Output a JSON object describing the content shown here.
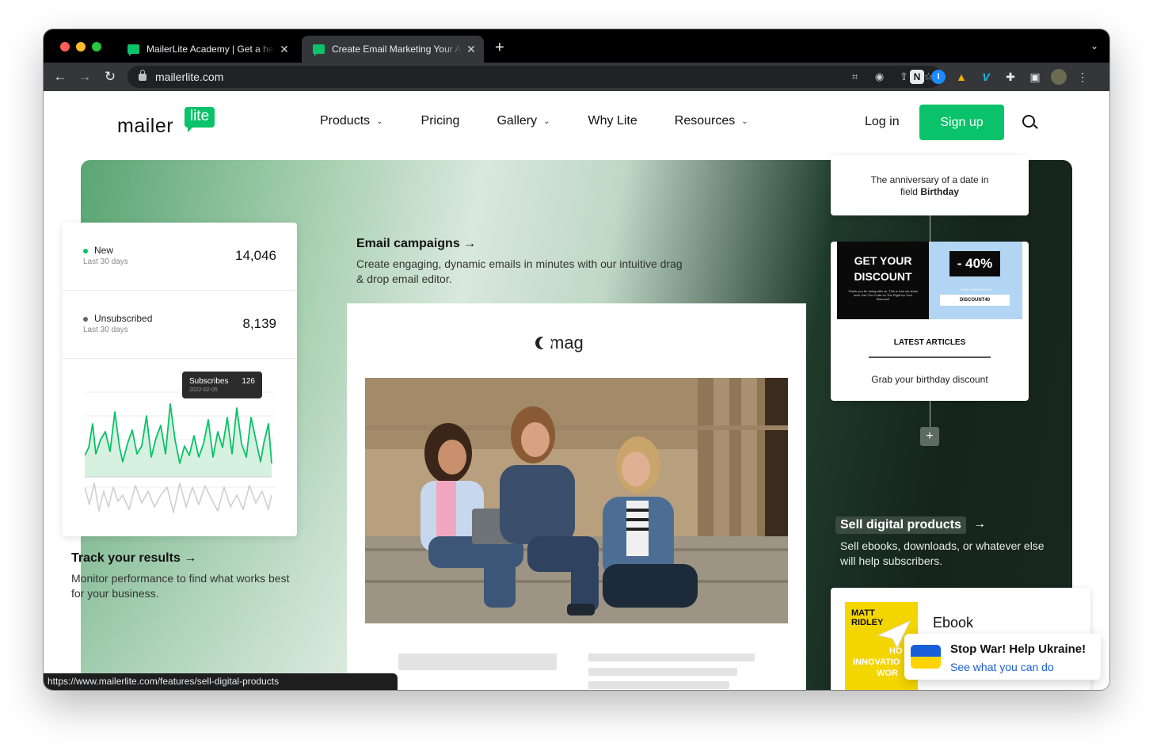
{
  "browser": {
    "tabs": [
      {
        "title": "MailerLite Academy | Get a head start with email",
        "close": "✕"
      },
      {
        "title": "Create Email Marketing Your Audience Will Love",
        "close": "✕"
      }
    ],
    "new_tab": "+",
    "tab_menu": "⌄",
    "url": "mailerlite.com",
    "nav": {
      "back": "←",
      "forward": "→",
      "reload": "↻"
    },
    "status_url": "https://www.mailerlite.com/features/sell-digital-products"
  },
  "header": {
    "logo_word": "mailer",
    "logo_badge": "lite",
    "nav": [
      {
        "label": "Products",
        "has_menu": true
      },
      {
        "label": "Pricing",
        "has_menu": false
      },
      {
        "label": "Gallery",
        "has_menu": true
      },
      {
        "label": "Why Lite",
        "has_menu": false
      },
      {
        "label": "Resources",
        "has_menu": true
      }
    ],
    "login": "Log in",
    "signup": "Sign up"
  },
  "stats": {
    "items": [
      {
        "label": "New",
        "sub": "Last 30 days",
        "value": "14,046",
        "dot_color": "#09c269"
      },
      {
        "label": "Unsubscribed",
        "sub": "Last 30 days",
        "value": "8,139",
        "dot_color": "#666666"
      }
    ],
    "tooltip": {
      "label": "Subscribes",
      "value": "126",
      "date": "2022-02-05"
    }
  },
  "features": {
    "track": {
      "title": "Track your results",
      "desc": "Monitor performance to find what works best for your business."
    },
    "email": {
      "title": "Email campaigns",
      "desc": "Create engaging, dynamic emails in minutes with our intuitive drag & drop email editor."
    },
    "sell": {
      "title": "Sell digital products",
      "desc": "Sell ebooks, downloads, or whatever else will help subscribers."
    }
  },
  "newsletter": {
    "brand": "mag"
  },
  "automation": {
    "trigger": {
      "line1": "The anniversary of a date in",
      "line2_prefix": "field ",
      "line2_bold": "Birthday"
    },
    "promo": {
      "headline_1": "GET YOUR",
      "headline_2": "DISCOUNT",
      "small_text": "Thank you for being with us. This is how we show love! Use The Code on The Right for Your Discount!",
      "percent": "- 40%",
      "code_hint": "YOUR CODE BELOW",
      "code": "DISCOUNT40",
      "latest": "LATEST ARTICLES",
      "caption": "Grab your birthday discount"
    },
    "add": "+"
  },
  "ebook": {
    "author_1": "MATT",
    "author_2": "RIDLEY",
    "title_1": "HO",
    "title_2": "INNOVATIO",
    "title_3": "WOR",
    "label": "Ebook"
  },
  "ukraine": {
    "title": "Stop War! Help Ukraine!",
    "link": "See what you can do"
  },
  "colors": {
    "brand_green": "#09c269",
    "dark_green": "#15241c"
  }
}
